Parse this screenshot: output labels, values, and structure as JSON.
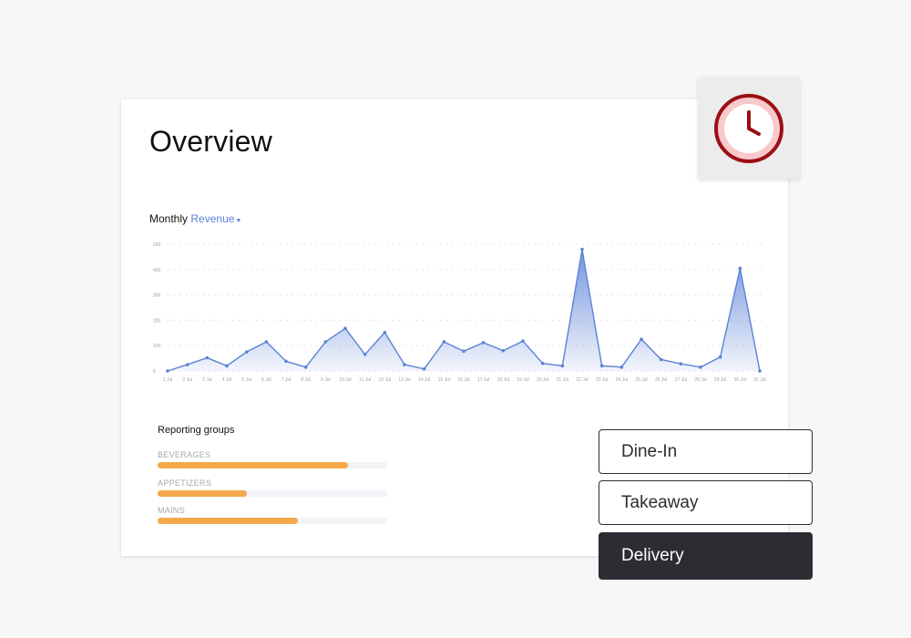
{
  "overview": {
    "title": "Overview"
  },
  "chart_heading": {
    "prefix": "Monthly",
    "metric": "Revenue"
  },
  "chart_data": {
    "type": "area",
    "x": [
      "1 Jul",
      "2 Jul",
      "3 Jul",
      "4 Jul",
      "5 Jul",
      "6 Jul",
      "7 Jul",
      "8 Jul",
      "9 Jul",
      "10 Jul",
      "11 Jul",
      "12 Jul",
      "13 Jul",
      "14 Jul",
      "15 Jul",
      "16 Jul",
      "17 Jul",
      "18 Jul",
      "19 Jul",
      "20 Jul",
      "21 Jul",
      "22 Jul",
      "23 Jul",
      "24 Jul",
      "25 Jul",
      "26 Jul",
      "27 Jul",
      "28 Jul",
      "29 Jul",
      "30 Jul",
      "31 Jul"
    ],
    "values": [
      0,
      25,
      52,
      20,
      75,
      115,
      38,
      15,
      115,
      168,
      65,
      152,
      25,
      8,
      115,
      78,
      112,
      80,
      118,
      30,
      20,
      480,
      20,
      15,
      125,
      45,
      28,
      15,
      55,
      405,
      0
    ],
    "yticks": [
      0,
      100,
      200,
      300,
      400,
      500
    ],
    "ylim": [
      0,
      500
    ],
    "grid": true,
    "line_color": "#5b82d6"
  },
  "reporting": {
    "title": "Reporting groups",
    "groups": [
      {
        "label": "BEVERAGES",
        "fraction": 0.83
      },
      {
        "label": "APPETIZERS",
        "fraction": 0.39
      },
      {
        "label": "MAINS",
        "fraction": 0.61
      }
    ]
  },
  "order_modes": [
    {
      "label": "Dine-In",
      "active": false
    },
    {
      "label": "Takeaway",
      "active": false
    },
    {
      "label": "Delivery",
      "active": true
    }
  ],
  "icons": {
    "clock": "clock-icon",
    "caret": "caret-down-icon"
  },
  "colors": {
    "accent": "#5b82d6",
    "bar": "#f4a84a",
    "clock_ring": "#9b0f14",
    "clock_face": "#f8c9cb",
    "active_button": "#2c2d33"
  }
}
